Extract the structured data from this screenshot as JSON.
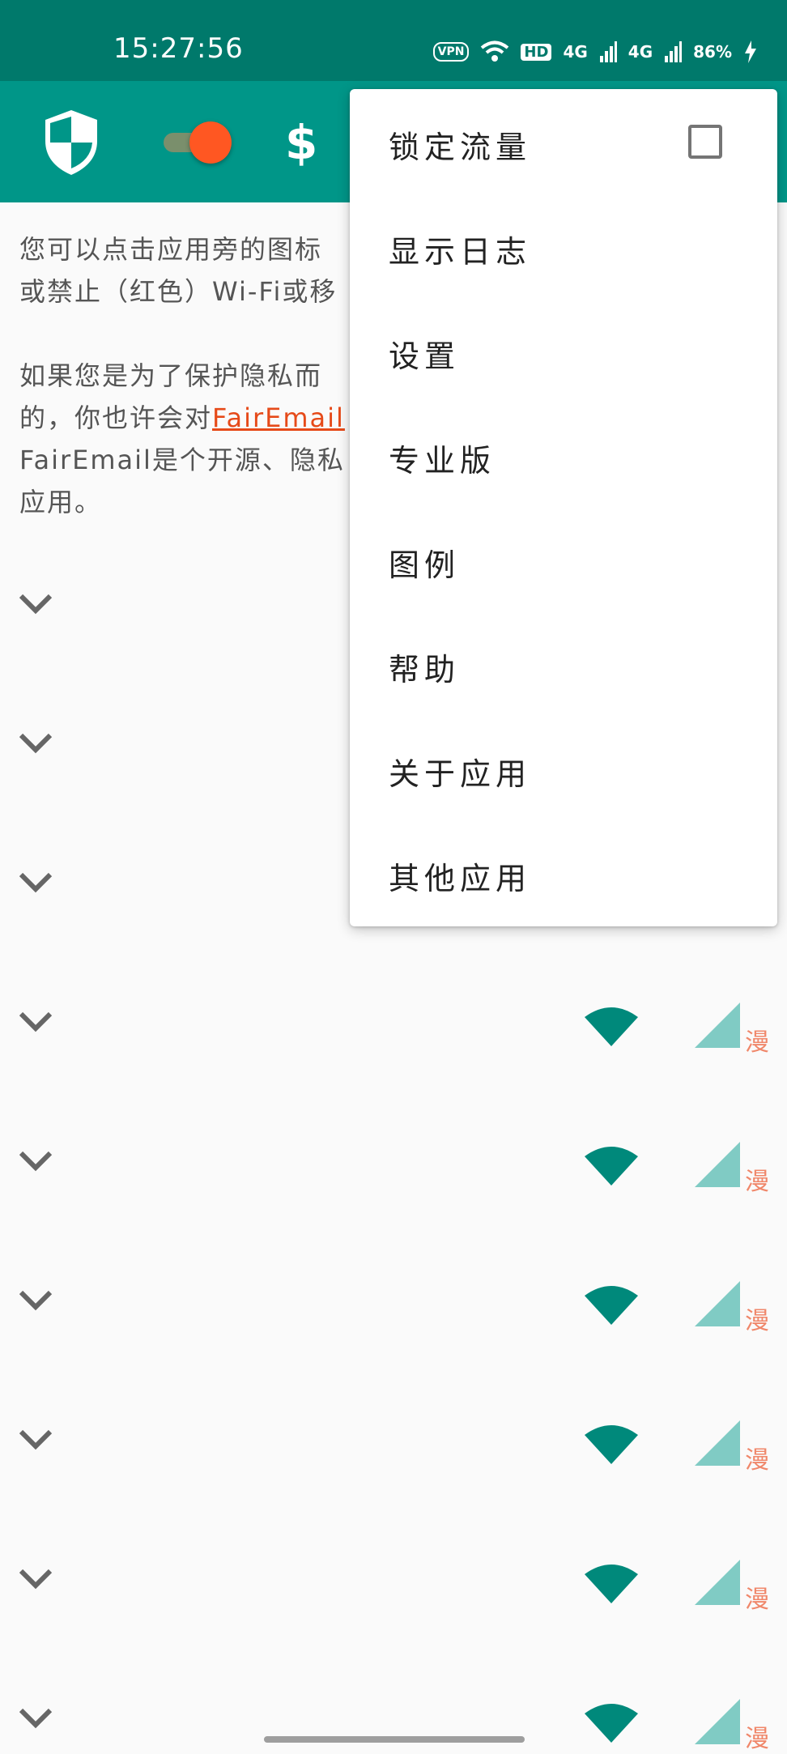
{
  "status_bar": {
    "time": "15:27:56",
    "vpn_label": "VPN",
    "hd_label": "HD",
    "net1": "4G",
    "net2": "4G",
    "battery": "86%"
  },
  "toolbar": {
    "shield_icon": "shield-icon",
    "toggle_state": "on",
    "dollar_label": "$",
    "colors": {
      "primary": "#009688",
      "primary_dark": "#00796b",
      "accent": "#ff5722"
    }
  },
  "intro": {
    "line1": "您可以点击应用旁的图标",
    "line2": "或禁止（红色）Wi-Fi或移",
    "line3": "如果您是为了保护隐私而",
    "line4a": "的，你也许会对",
    "link": "FairEmail",
    "line5": "FairEmail是个开源、隐私",
    "line6": "应用。"
  },
  "app_rows": [
    {
      "wifi": false,
      "mobile": false,
      "roaming": ""
    },
    {
      "wifi": false,
      "mobile": false,
      "roaming": ""
    },
    {
      "wifi": false,
      "mobile": false,
      "roaming": ""
    },
    {
      "wifi": true,
      "mobile": true,
      "roaming": "漫"
    },
    {
      "wifi": true,
      "mobile": true,
      "roaming": "漫"
    },
    {
      "wifi": true,
      "mobile": true,
      "roaming": "漫"
    },
    {
      "wifi": true,
      "mobile": true,
      "roaming": "漫"
    },
    {
      "wifi": true,
      "mobile": true,
      "roaming": "漫"
    },
    {
      "wifi": true,
      "mobile": true,
      "roaming": "漫"
    }
  ],
  "menu": {
    "items": [
      {
        "label": "锁定流量",
        "checkbox": true,
        "checked": false
      },
      {
        "label": "显示日志"
      },
      {
        "label": "设置"
      },
      {
        "label": "专业版"
      },
      {
        "label": "图例"
      },
      {
        "label": "帮助"
      },
      {
        "label": "关于应用"
      },
      {
        "label": "其他应用"
      }
    ]
  }
}
